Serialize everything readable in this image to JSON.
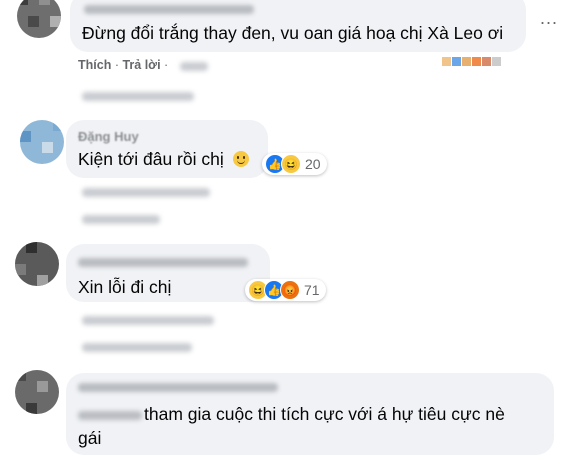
{
  "comments": [
    {
      "text": "Đừng đổi trắng thay đen, vu oan giá hoạ chị Xà Leo ơi",
      "actions": {
        "like": "Thích",
        "reply": "Trả lời"
      },
      "more": "..."
    },
    {
      "name": "Đặng Huy",
      "text": "Kiện tới đâu rồi chị",
      "reactions": {
        "count": "20"
      }
    },
    {
      "text": "Xin lỗi đi chị",
      "reactions": {
        "count": "71"
      }
    },
    {
      "text_line1": "tham gia cuộc thi tích cực với á hự tiêu cực nè",
      "text_line2": "gái"
    }
  ],
  "colors": {
    "bubble": "#f0f2f5",
    "meta": "#65676b",
    "like": "#1877f2"
  }
}
